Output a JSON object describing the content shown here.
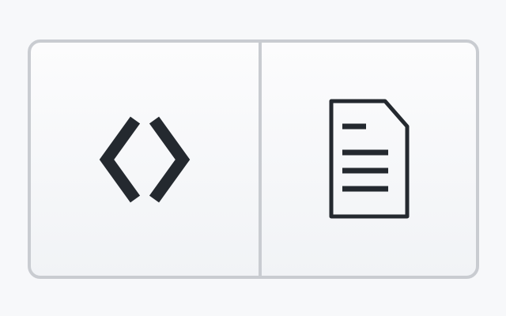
{
  "view_toggle": {
    "buttons": [
      {
        "id": "code",
        "icon": "code-brackets-icon"
      },
      {
        "id": "document",
        "icon": "document-icon"
      }
    ]
  },
  "colors": {
    "border": "#c9ccd1",
    "icon": "#24292f",
    "background": "#f7f8fa"
  }
}
